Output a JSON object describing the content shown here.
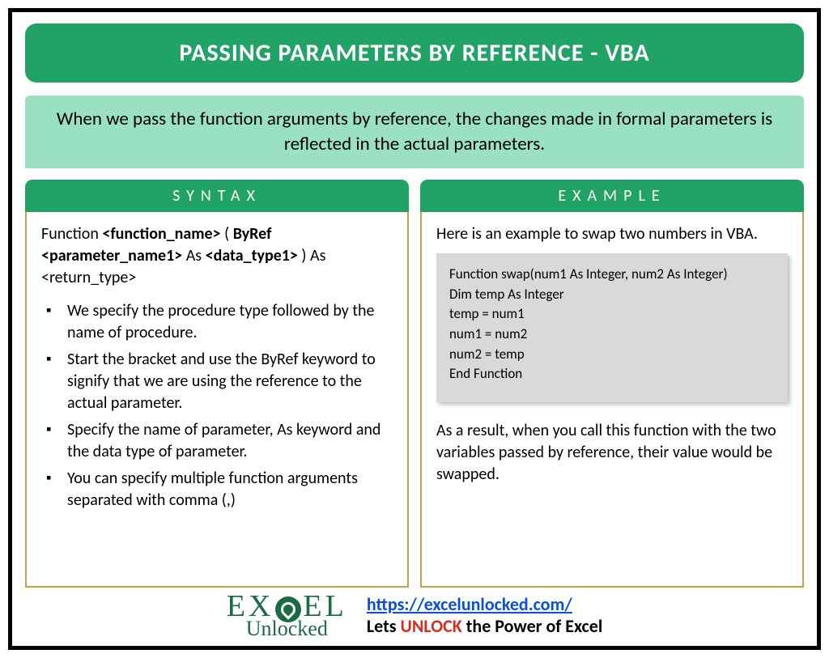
{
  "title": "PASSING PARAMETERS BY REFERENCE - VBA",
  "description": "When we pass the function arguments by reference, the changes made in formal parameters is reflected in the actual parameters.",
  "syntax": {
    "heading": "SYNTAX",
    "prefix": "Function",
    "fn": "<function_name>",
    "open": " ( ",
    "byref": "ByRef ",
    "param": "<parameter_name1>",
    "as": " As ",
    "dtype": "<data_type1>",
    "close": " ) As ",
    "ret": "<return_type>",
    "bullets": [
      "We specify the procedure type followed by the name of procedure.",
      "Start the bracket and use the ByRef keyword to signify that we are using the reference to the actual parameter.",
      "Specify the name of parameter, As keyword and the data type of parameter.",
      "You can specify multiple function arguments separated with comma (,)"
    ]
  },
  "example": {
    "heading": "EXAMPLE",
    "intro": "Here is an example to swap two numbers in VBA.",
    "code": [
      "Function swap(num1 As Integer, num2 As Integer)",
      "Dim temp As Integer",
      "temp = num1",
      "num1 = num2",
      "num2 = temp",
      "End Function"
    ],
    "result": "As a result, when you call this function with the two variables passed by reference, their value would be swapped."
  },
  "footer": {
    "logo_top_1": "EX",
    "logo_top_2": "EL",
    "logo_bottom": "Unlocked",
    "url": "https://excelunlocked.com/",
    "tagline_1": "Lets ",
    "tagline_unlock": "UNLOCK",
    "tagline_2": " the Power of Excel"
  }
}
